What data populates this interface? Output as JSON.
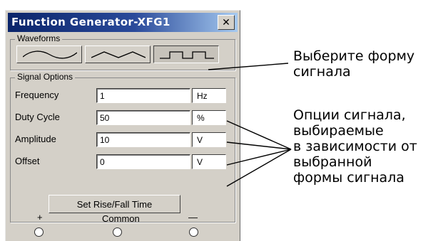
{
  "window": {
    "title": "Function Generator-XFG1",
    "close_glyph": "✕"
  },
  "waveforms": {
    "group_label": "Waveforms",
    "buttons": [
      {
        "name": "sine",
        "selected": false
      },
      {
        "name": "triangle",
        "selected": false
      },
      {
        "name": "square",
        "selected": true
      }
    ]
  },
  "signal_options": {
    "group_label": "Signal Options",
    "rows": [
      {
        "label": "Frequency",
        "value": "1",
        "unit": "Hz"
      },
      {
        "label": "Duty Cycle",
        "value": "50",
        "unit": "%"
      },
      {
        "label": "Amplitude",
        "value": "10",
        "unit": "V"
      },
      {
        "label": "Offset",
        "value": "0",
        "unit": "V"
      }
    ],
    "rise_fall_button": "Set Rise/Fall Time"
  },
  "terminals": {
    "plus": "+",
    "common": "Common",
    "minus": "—"
  },
  "annotations": {
    "waveform_note": [
      "Выберите форму",
      "сигнала"
    ],
    "options_note": [
      "Опции сигнала,",
      "выбираемые",
      "в зависимости от",
      "выбранной",
      "формы сигнала"
    ]
  }
}
